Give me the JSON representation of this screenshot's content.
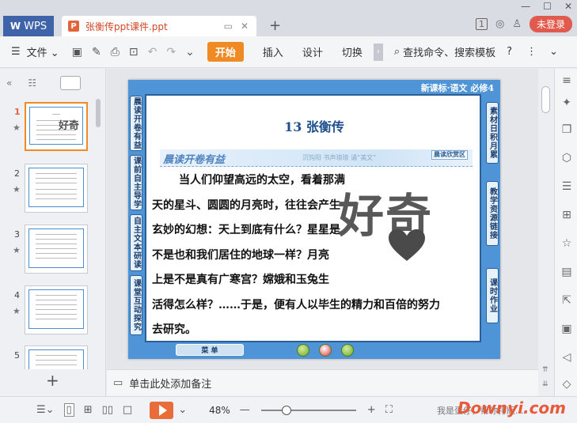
{
  "titlebar": {
    "app_name": "WPS",
    "doc_tab": "张衡传ppt课件.ppt",
    "notif_count": "1",
    "login_label": "未登录"
  },
  "menubar": {
    "file_label": "文件",
    "start_label": "开始",
    "tabs": [
      "插入",
      "设计",
      "切换"
    ],
    "search_label": "查找命令、搜索模板",
    "help": "?"
  },
  "thumbnails": [
    {
      "num": "1",
      "selected": true
    },
    {
      "num": "2",
      "selected": false
    },
    {
      "num": "3",
      "selected": false
    },
    {
      "num": "4",
      "selected": false
    },
    {
      "num": "5",
      "selected": false
    }
  ],
  "slide": {
    "header": "新课标·语文   必修4",
    "title": "13  张衡传",
    "left_tabs": [
      "晨读开卷有益",
      "课前自主导学",
      "自主文本研读",
      "课堂互动探究"
    ],
    "right_tabs": [
      "素材日积月累",
      "教学资源链接",
      "课时作业"
    ],
    "banner_title": "晨读开卷有益",
    "banner_sub": "沉钩阳  书声琅琅  诵“美文”",
    "banner_link": "晨读欣赏区",
    "paragraph": [
      "当人们仰望高远的太空，看着那满",
      "天的星斗、圆圆的月亮时，往往会产生",
      "玄妙的幻想：天上到底有什么？星星是",
      "不是也和我们居住的地球一样？月亮",
      "上是不是真有广寒宫？嫦娥和玉兔生",
      "活得怎么样？……于是，便有人以毕生的精力和百倍的努力",
      "去研究。"
    ],
    "footer_btn": "菜  单"
  },
  "watermark_text": "好奇",
  "notes_placeholder": "单击此处添加备注",
  "statusbar": {
    "zoom": "48%",
    "zoom_level": 0.48,
    "assistant_text": "我是蛋仔，帮你排版...",
    "brand": "Downyi.com"
  },
  "colors": {
    "accent": "#f08a24",
    "slide_blue": "#4f94d6",
    "login_red": "#e05a4e"
  },
  "icons": {
    "right_sidebar": [
      "sparkle-icon",
      "copy-icon",
      "shape-icon",
      "sliders-icon",
      "image-gallery-icon",
      "star-icon",
      "archive-icon",
      "share-icon",
      "picture-icon",
      "volume-icon",
      "shield-icon"
    ]
  }
}
